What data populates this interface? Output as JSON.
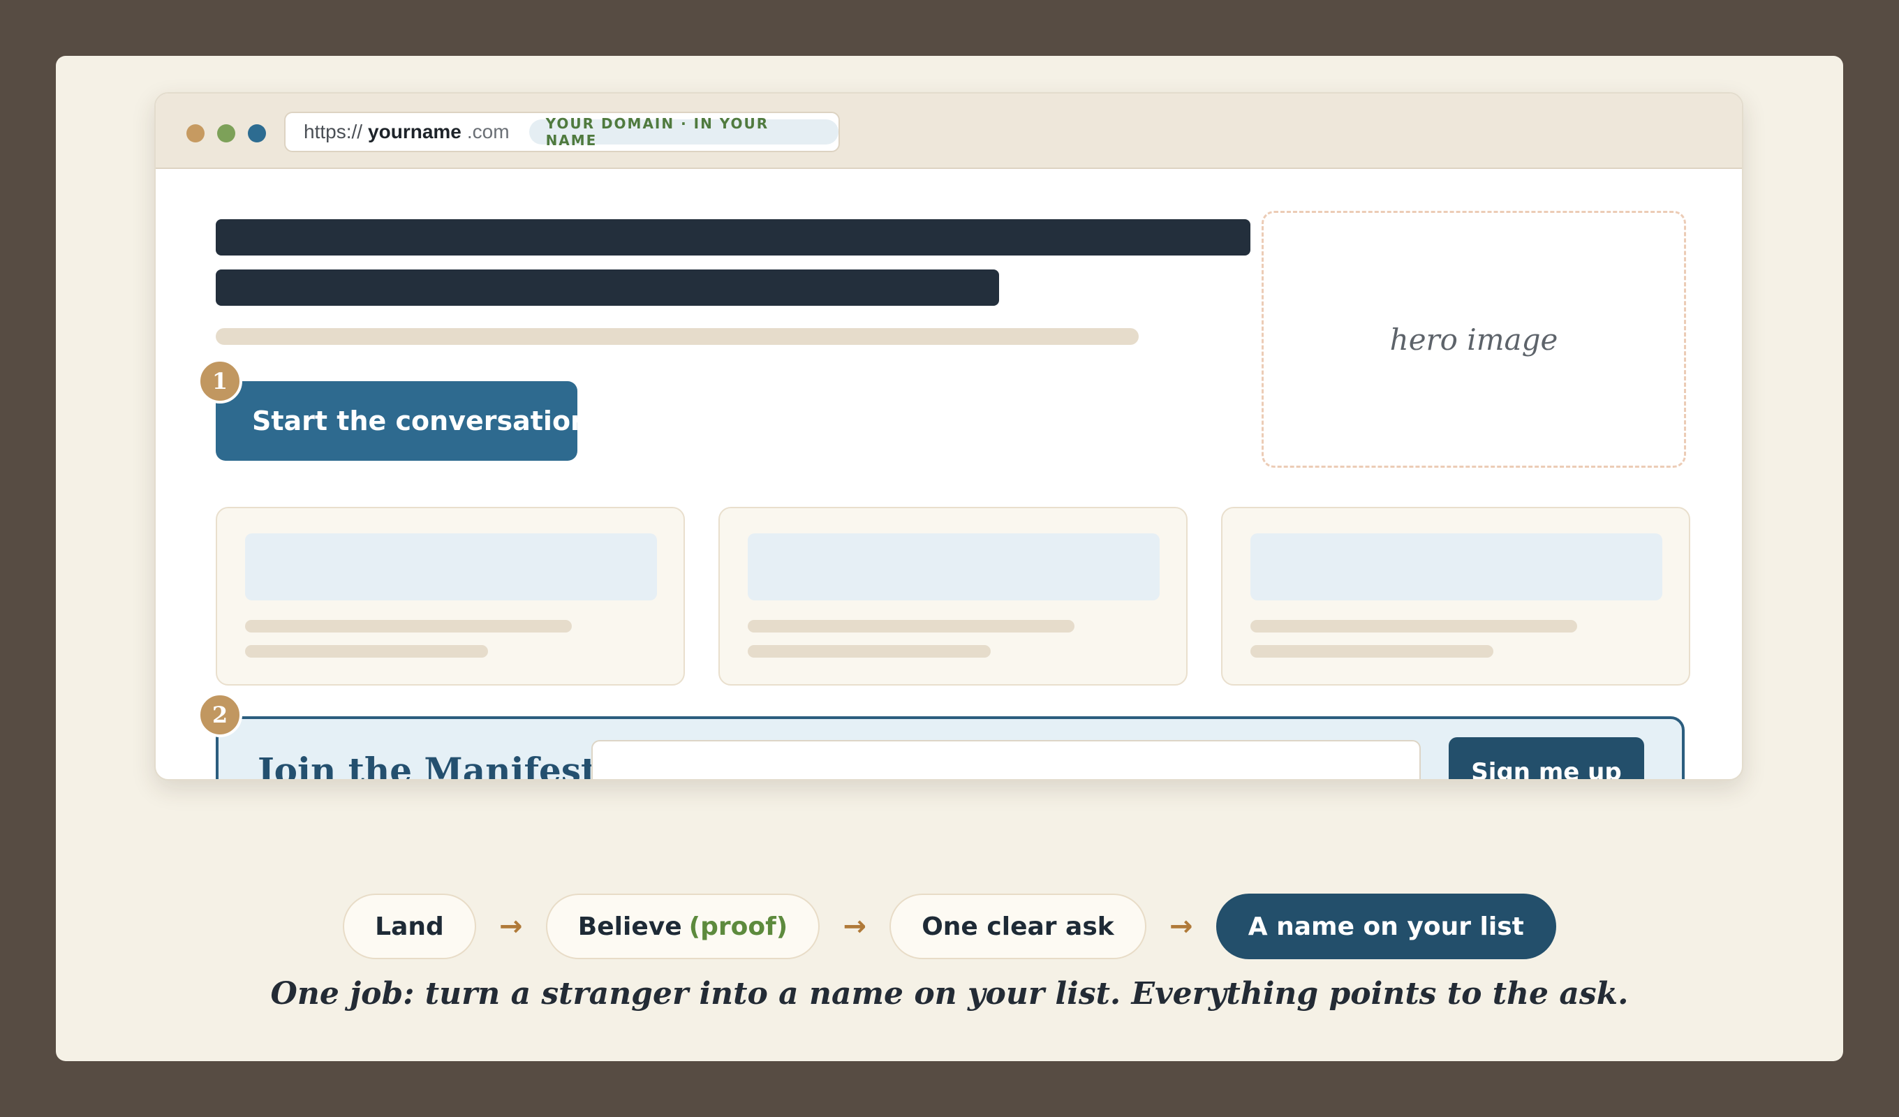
{
  "browser": {
    "url": {
      "scheme": "https://",
      "name": "yourname",
      "tld": ".com",
      "badge": "YOUR DOMAIN · IN YOUR NAME"
    },
    "window_dots": [
      "close-dot",
      "minimize-dot",
      "maximize-dot"
    ]
  },
  "page": {
    "cta_label": "Start the conversation",
    "hero_label": "hero image",
    "step_badges": [
      "1",
      "2"
    ],
    "signup": {
      "title": "Join the Manifest",
      "email_placeholder": "",
      "button_label": "Sign me up"
    }
  },
  "flow": {
    "steps": [
      {
        "label": "Land"
      },
      {
        "label": "Believe",
        "accent": "(proof)"
      },
      {
        "label": "One clear ask"
      },
      {
        "label": "A name on your list"
      }
    ],
    "arrow": "→"
  },
  "caption": "One job: turn a stranger into a name on your list. Everything points to the ask.",
  "colors": {
    "page_bg": "#574c43",
    "card_bg": "#f5f1e6",
    "cta_blue": "#2e6a8f",
    "navy": "#234f6b",
    "badge_gold": "#c19760",
    "proof_green": "#5d8a3d",
    "arrow_brown": "#b07a39"
  }
}
